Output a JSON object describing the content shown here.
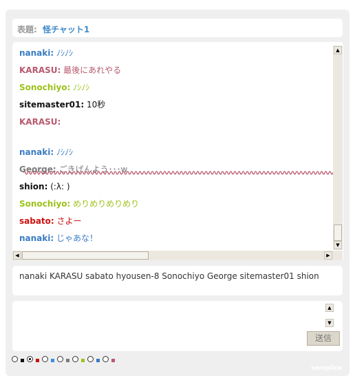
{
  "title": {
    "label": "表題:",
    "value": "怪チャット1"
  },
  "messages": [
    {
      "name": "nanaki:",
      "text": "ﾉｼﾉｼ",
      "name_color": "#3a7cc4",
      "text_color": "#3a7cc4"
    },
    {
      "name": "KARASU:",
      "text": "最後にあれやる",
      "name_color": "#b85a6e",
      "text_color": "#b85a6e"
    },
    {
      "name": "Sonochiyo:",
      "text": "ﾉｼﾉｼ",
      "name_color": "#9cc21a",
      "text_color": "#9cc21a"
    },
    {
      "name": "sitemaster01:",
      "text": "10秒",
      "name_color": "#111111",
      "text_color": "#111111"
    },
    {
      "name": "KARASU:",
      "text": "",
      "name_color": "#b85a6e",
      "text_color": "#b85a6e",
      "tall": true
    },
    {
      "name": "nanaki:",
      "text": "ﾉｼﾉｼ",
      "name_color": "#3a7cc4",
      "text_color": "#3a7cc4"
    },
    {
      "name": "George:",
      "text": "ごきげんよう･･･w",
      "name_color": "#7a7a7a",
      "text_color": "#7a7a7a"
    },
    {
      "name": "shion:",
      "text": "(:λ: )",
      "name_color": "#111111",
      "text_color": "#111111"
    },
    {
      "name": "Sonochiyo:",
      "text": "めりめりめりめり",
      "name_color": "#9cc21a",
      "text_color": "#9cc21a"
    },
    {
      "name": "sabato:",
      "text": "さよー",
      "name_color": "#cc1111",
      "text_color": "#cc1111"
    },
    {
      "name": "nanaki:",
      "text": "じゃあな！",
      "name_color": "#3a7cc4",
      "text_color": "#3a7cc4"
    }
  ],
  "wave_color": "#b85a6e",
  "users": "nanaki KARASU sabato hyousen-8 Sonochiyo George sitemaster01 shion",
  "input": {
    "value": "",
    "placeholder": ""
  },
  "send_label": "送信",
  "color_options": [
    {
      "swatch": "#111111",
      "selected": false
    },
    {
      "swatch": "#cc1111",
      "selected": true
    },
    {
      "swatch": "#3a8ee6",
      "selected": false
    },
    {
      "swatch": "#7a7a7a",
      "selected": false
    },
    {
      "swatch": "#9cc21a",
      "selected": false
    },
    {
      "swatch": "#3a7cc4",
      "selected": false
    },
    {
      "swatch": "#b85a6e",
      "selected": false
    }
  ],
  "brand": "semplica"
}
